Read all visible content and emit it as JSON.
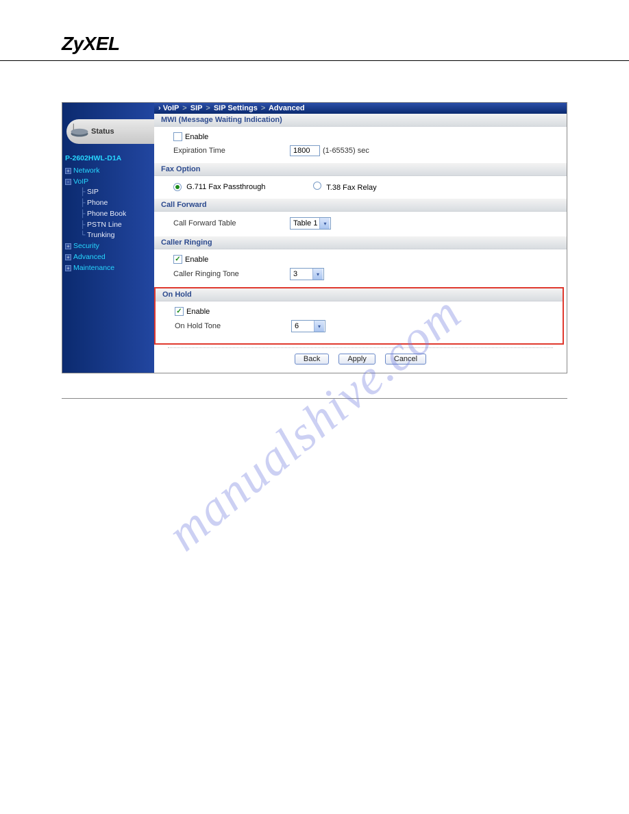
{
  "logo": "ZyXEL",
  "sidebar": {
    "status": "Status",
    "model": "P-2602HWL-D1A",
    "items": [
      {
        "label": "Network",
        "type": "top"
      },
      {
        "label": "VoIP",
        "type": "top-open"
      },
      {
        "label": "SIP",
        "type": "sub"
      },
      {
        "label": "Phone",
        "type": "sub"
      },
      {
        "label": "Phone Book",
        "type": "sub"
      },
      {
        "label": "PSTN Line",
        "type": "sub"
      },
      {
        "label": "Trunking",
        "type": "sub"
      },
      {
        "label": "Security",
        "type": "top"
      },
      {
        "label": "Advanced",
        "type": "top"
      },
      {
        "label": "Maintenance",
        "type": "top"
      }
    ]
  },
  "breadcrumb": [
    "VoIP",
    "SIP",
    "SIP Settings",
    "Advanced"
  ],
  "sections": {
    "mwi": {
      "title": "MWI (Message Waiting Indication)",
      "enable_label": "Enable",
      "enable_checked": false,
      "exp_label": "Expiration Time",
      "exp_value": "1800",
      "exp_hint": "(1-65535) sec"
    },
    "fax": {
      "title": "Fax Option",
      "opt1": "G.711 Fax Passthrough",
      "opt2": "T.38 Fax Relay",
      "selected": 0
    },
    "cf": {
      "title": "Call Forward",
      "label": "Call Forward Table",
      "value": "Table 1"
    },
    "cr": {
      "title": "Caller Ringing",
      "enable_label": "Enable",
      "enable_checked": true,
      "tone_label": "Caller Ringing Tone",
      "tone_value": "3"
    },
    "oh": {
      "title": "On Hold",
      "enable_label": "Enable",
      "enable_checked": true,
      "tone_label": "On Hold Tone",
      "tone_value": "6"
    }
  },
  "buttons": {
    "back": "Back",
    "apply": "Apply",
    "cancel": "Cancel"
  },
  "watermark": "manualshive.com"
}
